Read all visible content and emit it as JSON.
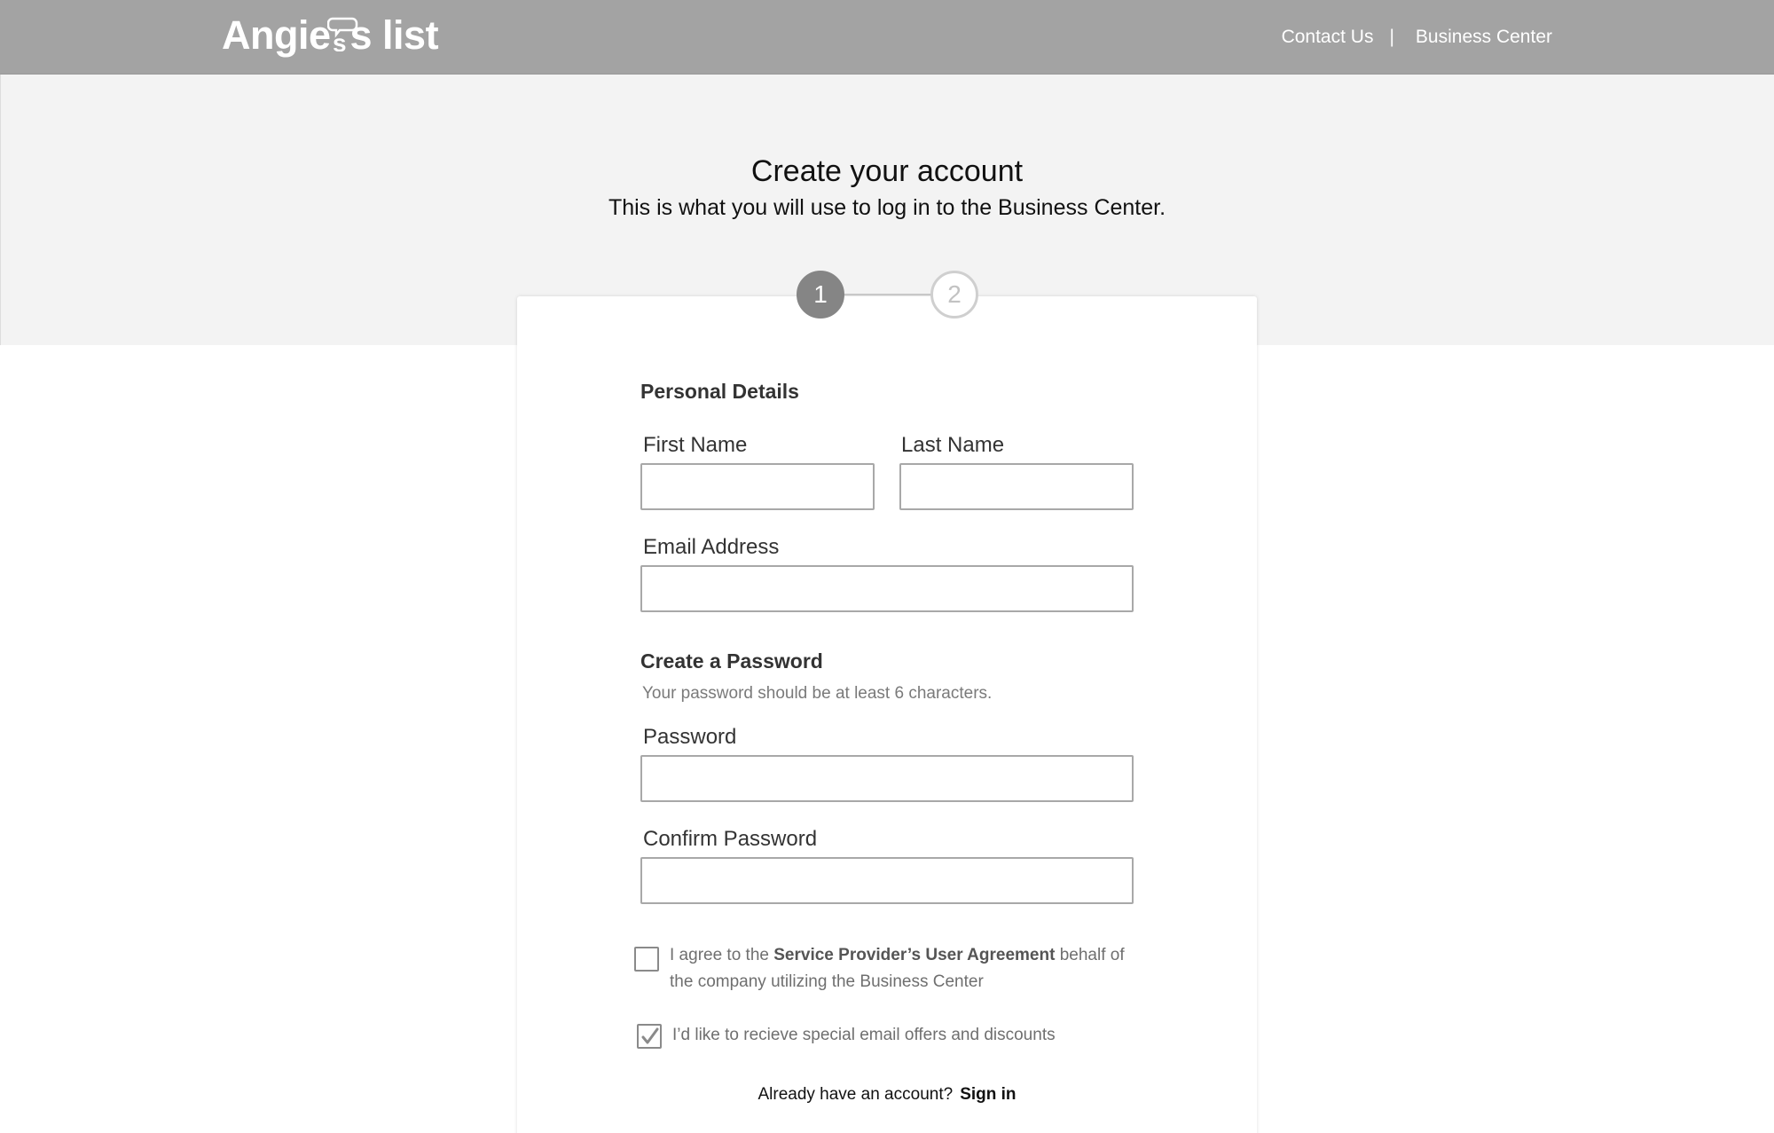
{
  "header": {
    "logo_text": "Angies list",
    "nav": {
      "contact": "Contact Us",
      "separator": "|",
      "business_center": "Business Center"
    }
  },
  "hero": {
    "title": "Create your account",
    "subtitle": "This is what you will use to log in to the Business Center."
  },
  "stepper": {
    "step1": "1",
    "step2": "2",
    "current_step": 1
  },
  "form": {
    "personal_details_title": "Personal Details",
    "first_name_label": "First Name",
    "first_name_value": "",
    "last_name_label": "Last Name",
    "last_name_value": "",
    "email_label": "Email Address",
    "email_value": "",
    "password_section_title": "Create a Password",
    "password_hint": "Your password should be at least 6 characters.",
    "password_label": "Password",
    "password_value": "",
    "confirm_password_label": "Confirm Password",
    "confirm_password_value": "",
    "agreement": {
      "prefix": "I agree to the ",
      "link": "Service Provider’s User Agreement",
      "suffix_line1": " behalf of",
      "line2": "the company utilizing the Business Center",
      "checked": false
    },
    "offers": {
      "label": "I’d like to recieve special email offers and discounts",
      "checked": true
    },
    "signin": {
      "prompt": "Already have an account?",
      "link": "Sign in"
    }
  },
  "colors": {
    "header_bg": "#a3a3a3",
    "hero_bg": "#f3f3f3",
    "step_active": "#858585",
    "step_inactive": "#cfcfcf"
  }
}
